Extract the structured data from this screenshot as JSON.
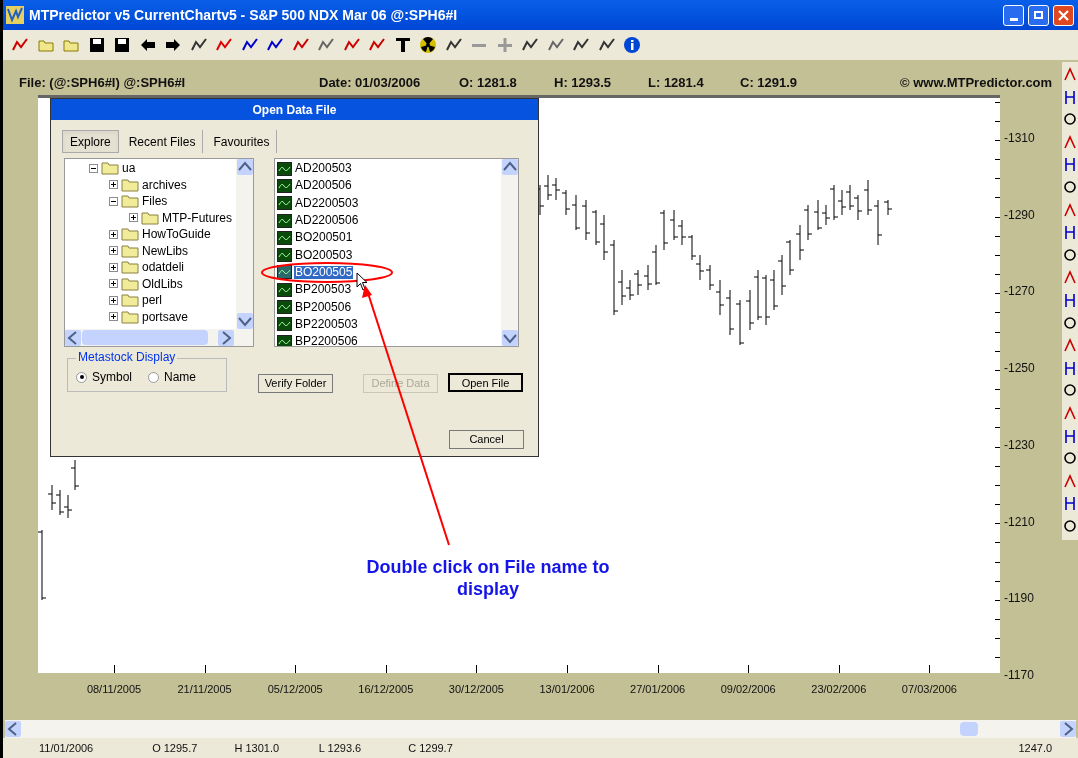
{
  "window": {
    "title": "MTPredictor v5 CurrentChartv5 - S&P 500 NDX Mar 06 @:SPH6#I"
  },
  "chart_header": {
    "file": "File: (@:SPH6#I) @:SPH6#I",
    "date": "Date: 01/03/2006",
    "open": "O:  1281.8",
    "high": "H:  1293.5",
    "low": "L:  1281.4",
    "close": "C:  1291.9",
    "site": "©  www.MTPredictor.com"
  },
  "price_axis": [
    "-1310",
    "-1290",
    "-1270",
    "-1250",
    "-1230",
    "-1210",
    "-1190",
    "-1170"
  ],
  "date_axis": [
    "08/11/2005",
    "21/11/2005",
    "05/12/2005",
    "16/12/2005",
    "30/12/2005",
    "13/01/2006",
    "27/01/2006",
    "09/02/2006",
    "23/02/2006",
    "07/03/2006"
  ],
  "status_bar": [
    "11/01/2006",
    "O 1295.7",
    "H 1301.0",
    "L 1293.6",
    "C 1299.7",
    "1247.0"
  ],
  "dialog": {
    "title": "Open Data File",
    "tabs": [
      {
        "label": "Explore",
        "selected": true
      },
      {
        "label": "Recent Files",
        "selected": false
      },
      {
        "label": "Favourites",
        "selected": false
      }
    ],
    "tree": [
      {
        "label": "ua",
        "expanded": true,
        "children": [
          {
            "label": "archives",
            "expanded": false
          },
          {
            "label": "Files",
            "expanded": true,
            "children": [
              {
                "label": "MTP-Futures",
                "expanded": false
              }
            ]
          },
          {
            "label": "HowToGuide",
            "expanded": false
          },
          {
            "label": "NewLibs",
            "expanded": false
          },
          {
            "label": "odatdeli",
            "expanded": false
          },
          {
            "label": "OldLibs",
            "expanded": false
          },
          {
            "label": "perl",
            "expanded": false
          },
          {
            "label": "portsave",
            "expanded": false
          }
        ]
      }
    ],
    "files": [
      {
        "label": "AD200503",
        "selected": false
      },
      {
        "label": "AD200506",
        "selected": false
      },
      {
        "label": "AD2200503",
        "selected": false
      },
      {
        "label": "AD2200506",
        "selected": false
      },
      {
        "label": "BO200501",
        "selected": false
      },
      {
        "label": "BO200503",
        "selected": false
      },
      {
        "label": "BO200505",
        "selected": true
      },
      {
        "label": "BP200503",
        "selected": false
      },
      {
        "label": "BP200506",
        "selected": false
      },
      {
        "label": "BP2200503",
        "selected": false
      },
      {
        "label": "BP2200506",
        "selected": false
      }
    ],
    "display_group": {
      "title": "Metastock Display",
      "options": [
        {
          "label": "Symbol",
          "selected": true
        },
        {
          "label": "Name",
          "selected": false
        }
      ]
    },
    "buttons": [
      {
        "label": "Verify Folder",
        "disabled": false,
        "default": false
      },
      {
        "label": "Define Data",
        "disabled": true,
        "default": false
      },
      {
        "label": "Open File",
        "disabled": false,
        "default": true
      }
    ],
    "cancel_button": {
      "label": "Cancel",
      "disabled": false,
      "default": false
    }
  },
  "annotation": {
    "text": "Double click on File name to display"
  }
}
